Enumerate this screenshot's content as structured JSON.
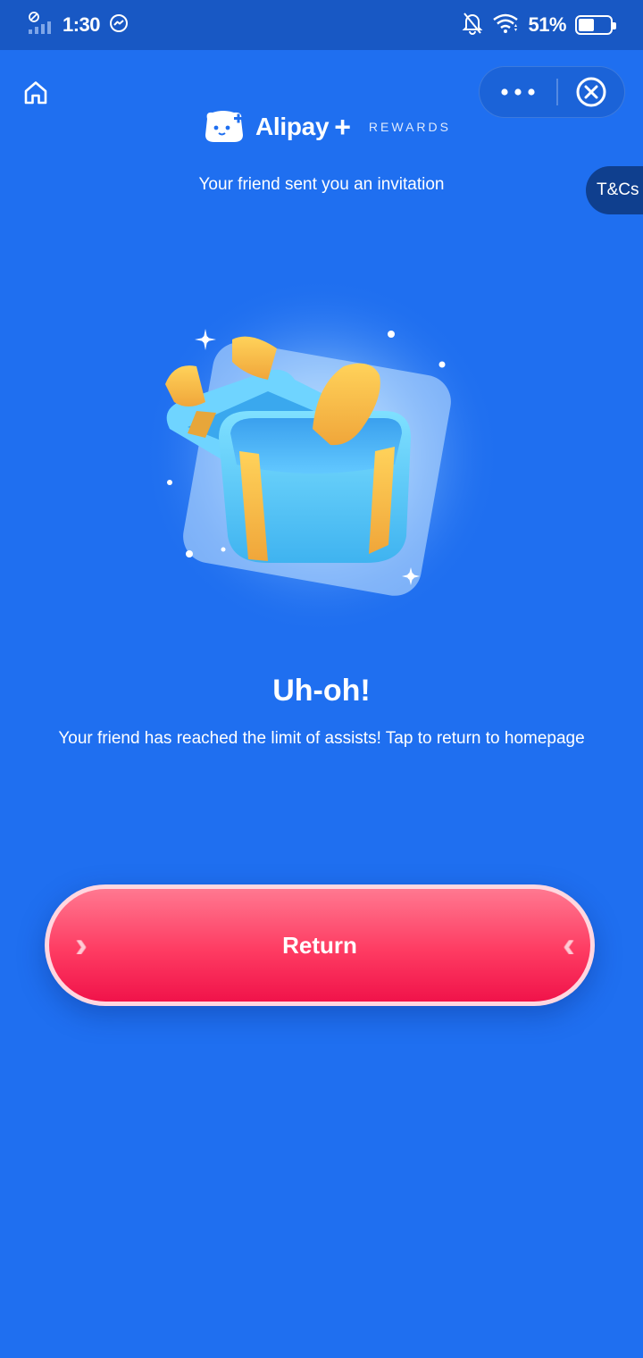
{
  "status_bar": {
    "time": "1:30",
    "battery": "51%",
    "battery_level": 0.51
  },
  "header": {
    "brand_name": "Alipay",
    "brand_plus": "+",
    "brand_tag": "REWARDS",
    "subtitle": "Your friend sent you an invitation",
    "tcs_label": "T&Cs"
  },
  "main": {
    "title": "Uh-oh!",
    "message": "Your friend has reached the limit of assists! Tap to return to homepage",
    "return_label": "Return"
  },
  "colors": {
    "background": "#1f6ff0",
    "status_bar": "#1858c4",
    "button": "#fe3b62",
    "tcs_tab": "#0f3f8e"
  }
}
